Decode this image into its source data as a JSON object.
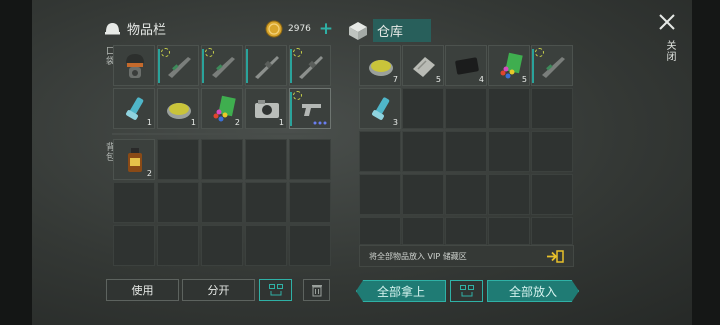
{
  "inventory": {
    "title": "物品栏",
    "pocket_label": "口袋",
    "backpack_label": "背包"
  },
  "coins": {
    "amount": "2976",
    "plus": "+"
  },
  "storage": {
    "title": "仓库",
    "close_label": "关闭",
    "vip_text": "将全部物品放入 VIP 储藏区"
  },
  "pocket_counts": {
    "s6": "1",
    "s7": "1",
    "s8": "2",
    "s9": "1"
  },
  "backpack_counts": {
    "s0": "2"
  },
  "storage_counts": {
    "s0": "7",
    "s1": "5",
    "s2": "4",
    "s3": "5",
    "s5": "3"
  },
  "buttons": {
    "use": "使用",
    "split": "分开",
    "take_all": "全部拿上",
    "put_all": "全部放入"
  },
  "icons": {
    "coin": "coin-icon",
    "close": "close-icon",
    "trash": "trash-icon",
    "sort": "sort-icon",
    "vip": "vip-transfer-icon"
  },
  "colors": {
    "accent": "#2fb1a6",
    "coin": "#d9a62c",
    "vip_arrow": "#e8c12a"
  }
}
